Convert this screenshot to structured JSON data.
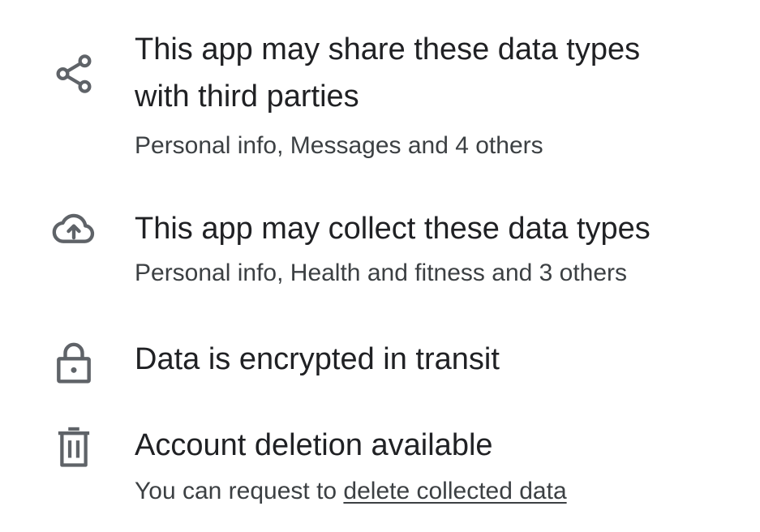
{
  "items": [
    {
      "icon": "share-icon",
      "title_line1": "This app may share these data types",
      "title_line2": "with third parties",
      "subtitle": "Personal info, Messages and 4 others"
    },
    {
      "icon": "cloud-upload-icon",
      "title": "This app may collect these data types",
      "subtitle": "Personal info, Health and fitness and 3 others"
    },
    {
      "icon": "lock-icon",
      "title": "Data is encrypted in transit"
    },
    {
      "icon": "trash-icon",
      "title": "Account deletion available",
      "subtitle_prefix": "You can request to ",
      "subtitle_link": "delete collected data"
    }
  ],
  "colors": {
    "primary_text": "#202124",
    "secondary_text": "#3c4043",
    "icon": "#5f6368",
    "background": "#ffffff"
  }
}
